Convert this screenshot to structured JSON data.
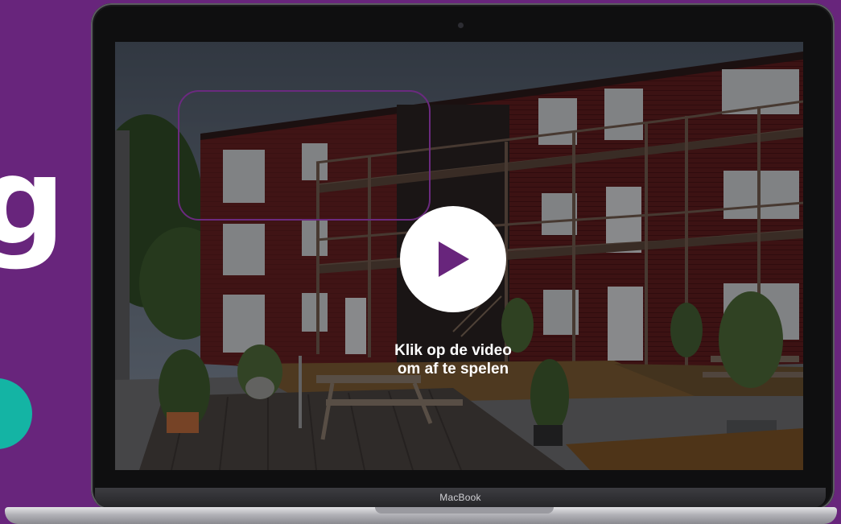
{
  "background_color": "#68257c",
  "accent_teal": "#14b4a4",
  "side_glyph": "g",
  "video": {
    "hint_line1": "Klik op de video",
    "hint_line2": "om af te spelen",
    "play_icon": "play-icon",
    "play_color": "#68257c"
  },
  "laptop": {
    "brand": "MacBook"
  }
}
